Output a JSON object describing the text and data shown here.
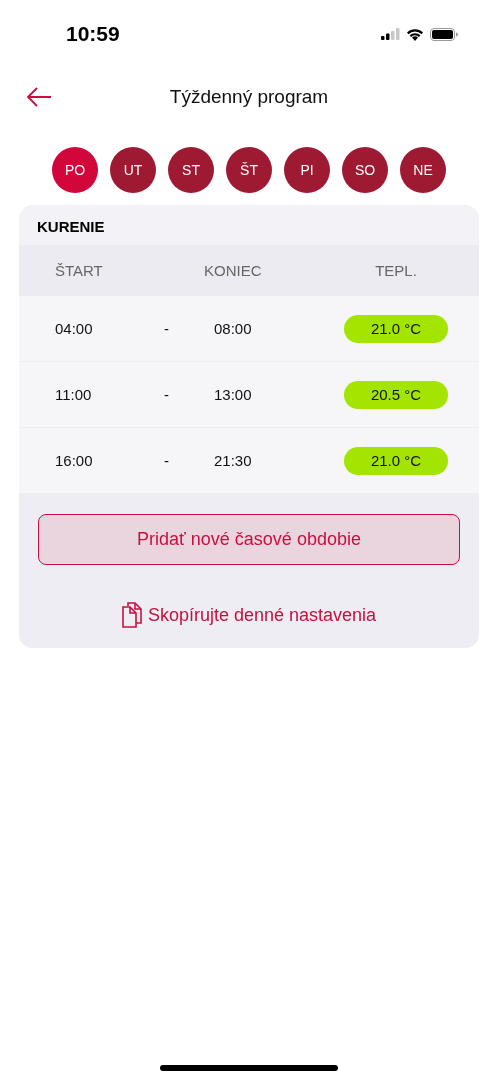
{
  "status_bar": {
    "time": "10:59"
  },
  "header": {
    "title": "Týždenný program"
  },
  "days": [
    {
      "label": "PO",
      "selected": true
    },
    {
      "label": "UT",
      "selected": false
    },
    {
      "label": "ST",
      "selected": false
    },
    {
      "label": "ŠT",
      "selected": false
    },
    {
      "label": "PI",
      "selected": false
    },
    {
      "label": "SO",
      "selected": false
    },
    {
      "label": "NE",
      "selected": false
    }
  ],
  "section": {
    "title": "KURENIE"
  },
  "table": {
    "columns": [
      "ŠTART",
      "KONIEC",
      "TEPL."
    ],
    "rows": [
      {
        "start": "04:00",
        "separator": "-",
        "end": "08:00",
        "temperature": "21.0 °C"
      },
      {
        "start": "11:00",
        "separator": "-",
        "end": "13:00",
        "temperature": "20.5 °C"
      },
      {
        "start": "16:00",
        "separator": "-",
        "end": "21:30",
        "temperature": "21.0 °C"
      }
    ]
  },
  "add_button": {
    "label": "Pridať nové časové obdobie"
  },
  "copy_link": {
    "label": "Skopírujte denné nastavenia"
  }
}
